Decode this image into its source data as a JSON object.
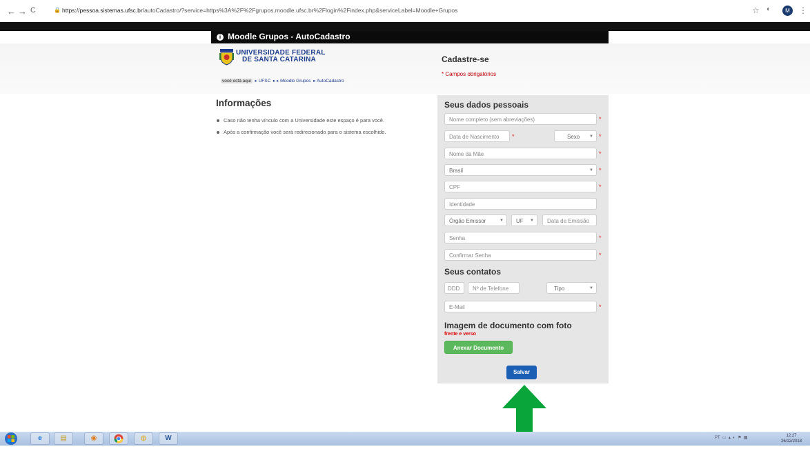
{
  "browser": {
    "nav": {
      "back": "←",
      "forward": "→",
      "reload": "C"
    },
    "url_host": "https://pessoa.sistemas.ufsc.br",
    "url_rest": "/autoCadastro/?service=https%3A%2F%2Fgrupos.moodle.ufsc.br%2Flogin%2Findex.php&serviceLabel=Moodle+Grupos",
    "avatar_letter": "M"
  },
  "header": {
    "title": "Moodle Grupos - AutoCadastro",
    "university_line1": "UNIVERSIDADE FEDERAL",
    "university_line2": "DE SANTA CATARINA",
    "breadcrumb": {
      "here": "você está aqui",
      "items": [
        "UFSC",
        "Moodle Grupos",
        "AutoCadastro"
      ]
    },
    "cadastre": "Cadastre-se",
    "required_note": "* Campos obrigatórios"
  },
  "info": {
    "heading": "Informações",
    "items": [
      "Caso não tenha vínculo com a Universidade este espaço é para você.",
      "Após a confirmação você será redirecionado para o sistema escolhido."
    ]
  },
  "form": {
    "personal_heading": "Seus dados pessoais",
    "nome": "Nome completo (sem abreviações)",
    "nascimento": "Data de Nascimento",
    "sexo": "Sexo",
    "mae": "Nome da Mãe",
    "pais": "Brasil",
    "cpf": "CPF",
    "identidade": "Identidade",
    "orgao": "Órgão Emissor",
    "uf": "UF",
    "emissao": "Data de Emissão",
    "senha": "Senha",
    "confirmar": "Confirmar Senha",
    "contacts_heading": "Seus contatos",
    "ddd": "DDD",
    "telefone": "Nº de Telefone",
    "tipo": "Tipo",
    "email": "E-Mail",
    "doc_heading": "Imagem de documento com foto",
    "doc_sub": "frente e verso",
    "attach_button": "Anexar Documento",
    "save_button": "Salvar",
    "required_mark": "*"
  },
  "taskbar": {
    "tray_lang": "PT",
    "time": "12:27",
    "date": "26/12/2018"
  },
  "colors": {
    "save": "#1a5fb4",
    "attach": "#5cb85c",
    "arrow": "#0aa53a",
    "brand": "#1d3c8c"
  }
}
